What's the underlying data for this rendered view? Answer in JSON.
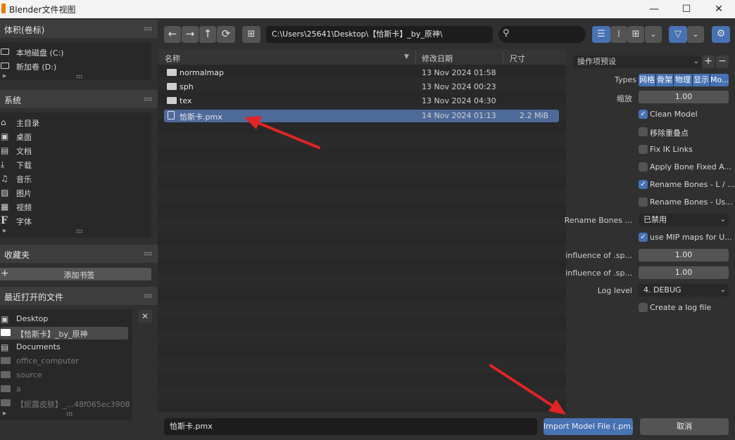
{
  "window": {
    "title": "Blender文件视图",
    "minimize": "—",
    "maximize": "☐",
    "close": "✕"
  },
  "sidebar": {
    "volumes": {
      "title": "体积(卷标)",
      "items": [
        {
          "icon": "disk-icon",
          "label": "本地磁盘 (C:)"
        },
        {
          "icon": "disk-icon",
          "label": "新加卷 (D:)"
        }
      ]
    },
    "system": {
      "title": "系统",
      "items": [
        {
          "icon": "home-icon",
          "label": "主目录"
        },
        {
          "icon": "desktop-icon",
          "label": "桌面"
        },
        {
          "icon": "documents-icon",
          "label": "文档"
        },
        {
          "icon": "download-icon",
          "label": "下载"
        },
        {
          "icon": "music-icon",
          "label": "音乐"
        },
        {
          "icon": "image-icon",
          "label": "图片"
        },
        {
          "icon": "video-icon",
          "label": "视频"
        },
        {
          "icon": "font-icon",
          "label": "字体"
        }
      ]
    },
    "bookmarks": {
      "title": "收藏夹",
      "add_label": "添加书签"
    },
    "recent": {
      "title": "最近打开的文件",
      "items": [
        {
          "label": "Desktop"
        },
        {
          "label": "【恰斯卡】_by_原神"
        },
        {
          "label": "Documents"
        },
        {
          "label": "office_computer"
        },
        {
          "label": "source"
        },
        {
          "label": "a"
        },
        {
          "label": "【妮露皮肤】_...48f065ec3908"
        }
      ]
    }
  },
  "toolbar": {
    "path": "C:\\Users\\25641\\Desktop\\【恰斯卡】_by_原神\\",
    "search_placeholder": ""
  },
  "filelist": {
    "headers": {
      "name": "名称",
      "date": "修改日期",
      "size": "尺寸"
    },
    "rows": [
      {
        "name": "normalmap",
        "date": "13 Nov 2024 01:58",
        "size": "",
        "type": "folder"
      },
      {
        "name": "sph",
        "date": "13 Nov 2024 00:23",
        "size": "",
        "type": "folder"
      },
      {
        "name": "tex",
        "date": "13 Nov 2024 04:30",
        "size": "",
        "type": "folder"
      },
      {
        "name": "恰斯卡.pmx",
        "date": "14 Nov 2024 01:13",
        "size": "2.2 MiB",
        "type": "file"
      }
    ]
  },
  "options": {
    "preset_label": "操作项预设",
    "types_label": "Types",
    "types": [
      "网格",
      "骨架",
      "物理",
      "显示",
      "Mo..."
    ],
    "scale_label": "缩放",
    "scale_value": "1.00",
    "checks": [
      {
        "label": "Clean Model",
        "checked": true
      },
      {
        "label": "移除重叠点",
        "checked": false
      },
      {
        "label": "Fix IK Links",
        "checked": false
      },
      {
        "label": "Apply Bone Fixed A...",
        "checked": false
      },
      {
        "label": "Rename Bones - L / ...",
        "checked": true
      },
      {
        "label": "Rename Bones - Us...",
        "checked": false
      }
    ],
    "rename_label": "Rename Bones ...",
    "rename_value": "已禁用",
    "mip_label": "use MIP maps for U...",
    "mip_checked": true,
    "influence1_label": "influence of .sp...",
    "influence1_value": "1.00",
    "influence2_label": "influence of .sp...",
    "influence2_value": "1.00",
    "log_label": "Log level",
    "log_value": "4. DEBUG",
    "create_log_label": "Create a log file",
    "create_log_checked": false
  },
  "bottom": {
    "filename": "恰斯卡.pmx",
    "import_label": "Import Model File (.pm...",
    "cancel_label": "取消"
  },
  "colors": {
    "accent": "#4772b3",
    "selection": "#4e6a9a",
    "arrow": "#e02424"
  }
}
